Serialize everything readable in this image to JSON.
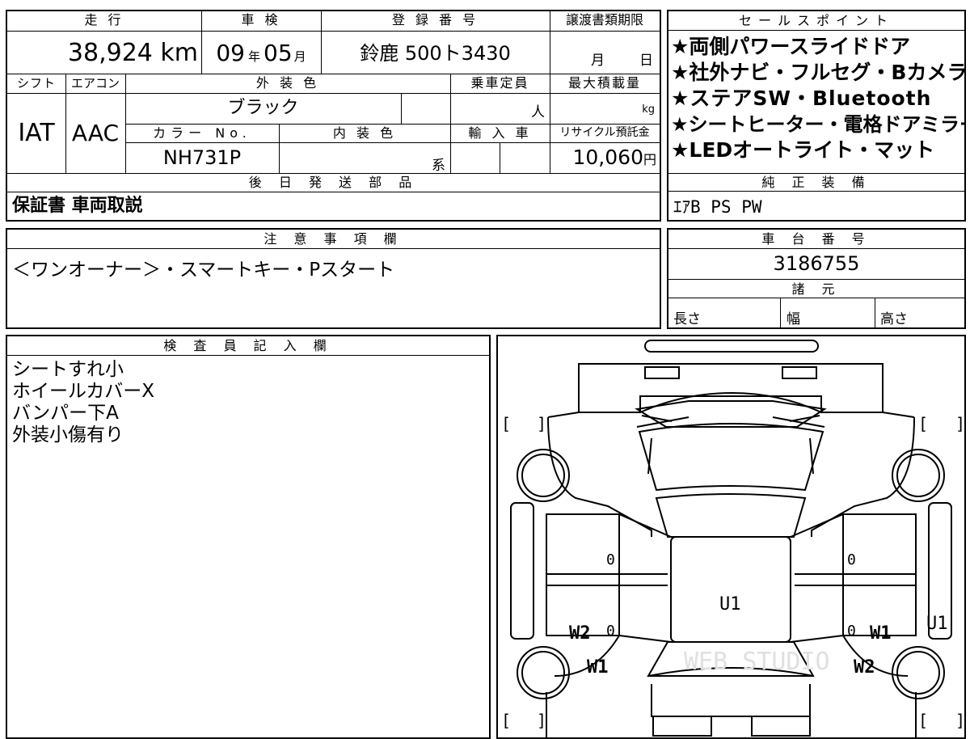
{
  "vehicle": {
    "mileage_label": "走 行",
    "mileage": "38,924 km",
    "inspection_label": "車 検",
    "inspection_year": "09",
    "inspection_year_unit": "年",
    "inspection_month": "05",
    "inspection_month_unit": "月",
    "registration_label": "登 録 番 号",
    "registration_number": "鈴鹿 500ト3430",
    "transfer_deadline_label": "譲渡書類期限",
    "transfer_month_unit": "月",
    "transfer_day_unit": "日",
    "shift_label": "シフト",
    "shift": "IAT",
    "aircon_label": "エアコン",
    "aircon": "AAC",
    "exterior_color_label": "外 装 色",
    "exterior_color": "ブラック",
    "capacity_label": "乗車定員",
    "capacity_unit": "人",
    "max_load_label": "最大積載量",
    "max_load_unit": "kg",
    "color_no_label": "カラー No.",
    "color_no": "NH731P",
    "interior_color_label": "内 装 色",
    "interior_color_unit": "系",
    "import_label": "輸 入 車",
    "recycle_label": "リサイクル預託金",
    "recycle_fee": "10,060",
    "recycle_unit": "円"
  },
  "later_parts": {
    "label": "後 日 発 送 部 品",
    "value": "保証書 車両取説"
  },
  "selling_points": {
    "label": "セールスポイント",
    "items": [
      "★両側パワースライドドア",
      "★社外ナビ・フルセグ・Bカメラ",
      "★ステアSW・Bluetooth",
      "★シートヒーター・電格ドアミラー",
      "★LEDオートライト・マット"
    ]
  },
  "genuine_equipment": {
    "label": "純 正 装 備",
    "value": "ｴｱB PS PW"
  },
  "caution": {
    "label": "注 意 事 項 欄",
    "value": "＜ワンオーナー＞・スマートキー・Pスタート"
  },
  "chassis": {
    "label": "車 台 番 号",
    "value": "3186755"
  },
  "specs": {
    "label": "諸 元",
    "length_label": "長さ",
    "width_label": "幅",
    "height_label": "高さ"
  },
  "inspector": {
    "label": "検 査 員 記 入 欄",
    "lines": [
      "シートすれ小",
      "ホイールカバーX",
      "バンパー下A",
      "外装小傷有り"
    ]
  },
  "diagram": {
    "roof_mark": "U1",
    "right_rear_mark": "U1",
    "left_w2": "W2",
    "left_w1": "W1",
    "right_w1": "W1",
    "right_w2": "W2",
    "zero": "0",
    "watermark": "WEB STUDIO"
  }
}
